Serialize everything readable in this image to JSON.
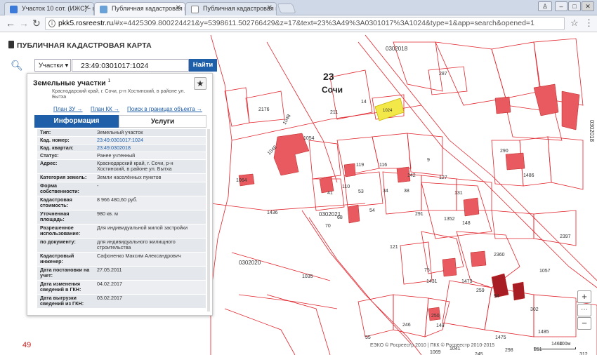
{
  "browser": {
    "tabs": [
      {
        "title": "Участок 10 сот. (ИЖС) - в"
      },
      {
        "title": "Публичная кадастровая к"
      },
      {
        "title": "Публичная кадастровая к"
      }
    ],
    "url_host": "pkk5.rosreestr.ru",
    "url_rest": "/#x=4425309.800224421&y=5398611.502766429&z=17&text=23%3A49%3A0301017%3A1024&type=1&app=search&opened=1"
  },
  "app": {
    "title": "ПУБЛИЧНАЯ КАДАСТРОВАЯ КАРТА",
    "layer_select": "Участки",
    "search_value": "23:49:0301017:1024",
    "find_label": "Найти"
  },
  "panel": {
    "heading": "Земельные участки",
    "heading_count": "1",
    "address_snippet": "Краснодарский край, г. Сочи, р-н Хостинский, в районе ул. Бытха",
    "links": [
      "План ЗУ →",
      "План КК →",
      "Поиск в границах объекта →"
    ],
    "tabs": [
      "Информация",
      "Услуги"
    ],
    "attributes": [
      {
        "label": "Тип:",
        "value": "Земельный участок"
      },
      {
        "label": "Кад. номер:",
        "value": "23:49:0301017:1024",
        "link": true
      },
      {
        "label": "Кад. квартал:",
        "value": "23:49:0302018",
        "link": true
      },
      {
        "label": "Статус:",
        "value": "Ранее учтенный"
      },
      {
        "label": "Адрес:",
        "value": "Краснодарский край, г. Сочи, р-н Хостинский, в районе ул. Бытха"
      },
      {
        "label": "Категория земель:",
        "value": "Земли населённых пунктов"
      },
      {
        "label": "Форма собственности:",
        "value": "-"
      },
      {
        "label": "Кадастровая стоимость:",
        "value": "8 966 480,60 руб."
      },
      {
        "label": "Уточненная площадь:",
        "value": "980 кв. м"
      },
      {
        "label": "Разрешенное использование:",
        "value": "Для индивидуальной жилой застройки"
      },
      {
        "label": "по документу:",
        "value": "для индивидуального жилищного строительства"
      },
      {
        "label": "Кадастровый инженер:",
        "value": "Сафоненко Максим Александрович"
      },
      {
        "label": "Дата постановки на учет:",
        "value": "27.05.2011"
      },
      {
        "label": "Дата изменения сведений в ГКН:",
        "value": "04.02.2017"
      },
      {
        "label": "Дата выгрузки сведений из ГКН:",
        "value": "03.02.2017"
      }
    ]
  },
  "map": {
    "region_number": "23",
    "city": "Сочи",
    "corner_number": "49",
    "quarter_labels": [
      "0302018",
      "0302021",
      "0302020",
      "0302018"
    ],
    "parcel_labels": [
      "287",
      "1024",
      "14",
      "2176",
      "211",
      "1054",
      "1048",
      "1046",
      "1064",
      "1436",
      "291",
      "1352",
      "121",
      "2360",
      "1035",
      "119",
      "53",
      "54",
      "68",
      "70",
      "110",
      "41",
      "116",
      "34",
      "38",
      "142",
      "9",
      "127",
      "131",
      "148",
      "259",
      "302",
      "290",
      "1486",
      "2397",
      "1057",
      "75",
      "1431",
      "1473",
      "94",
      "148",
      "246",
      "1475",
      "1485",
      "1460",
      "1041",
      "245",
      "298",
      "50",
      "15",
      "250",
      "1069",
      "250",
      "312",
      "55",
      "251"
    ],
    "attribution": "ЕЭКО © Росреестр 2010 | ПКК © Росреестр 2010-2015",
    "scale_label": "100м"
  },
  "colors": {
    "accent": "#1f5ea8",
    "parcel_line": "#e0232b",
    "building_fill": "#e85a5f",
    "selected_parcel": "#f3e84a"
  }
}
